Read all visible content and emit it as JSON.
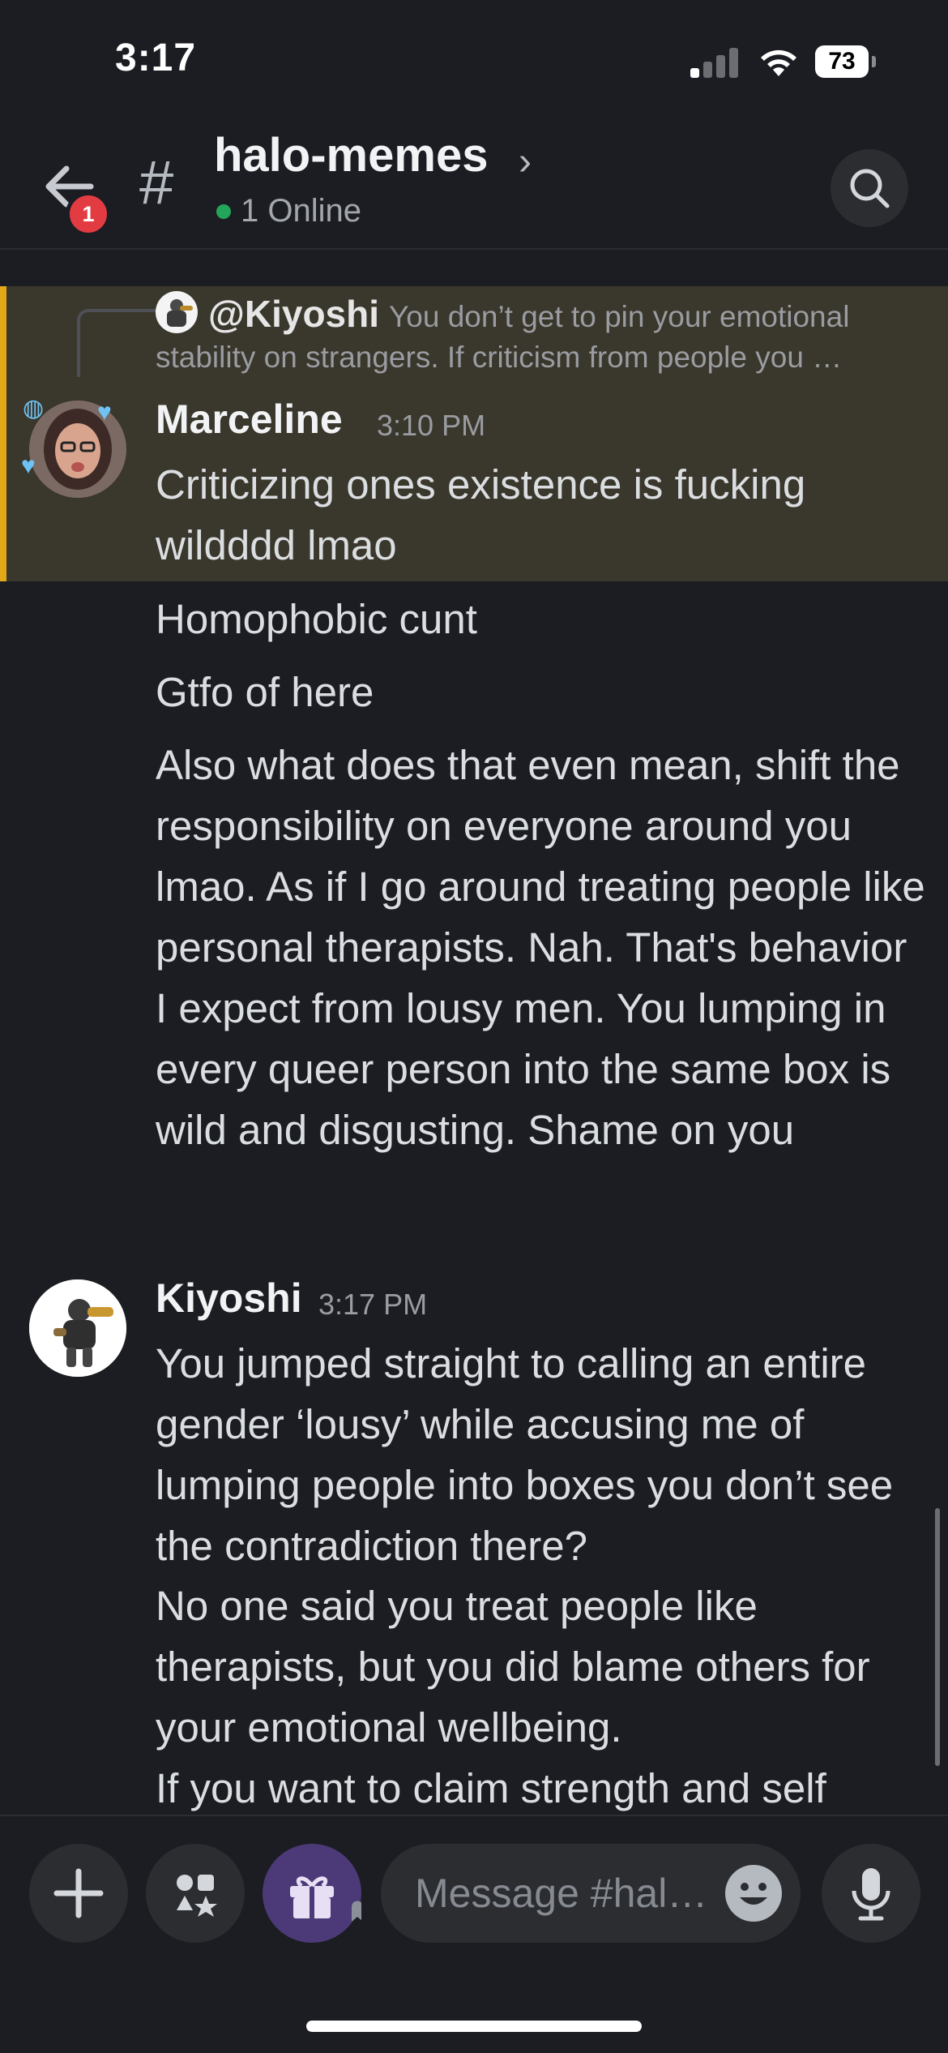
{
  "status_bar": {
    "time": "3:17",
    "battery": "73"
  },
  "header": {
    "channel_name": "halo-memes",
    "online_text": "1 Online",
    "back_badge": "1"
  },
  "reply_preview": {
    "author": "@Kiyoshi",
    "snippet_line1": "You don’t get to pin your emotional",
    "snippet_line2": "stability on strangers. If criticism from people you …"
  },
  "messages": [
    {
      "author": "Marceline",
      "time": "3:10 PM",
      "lines": [
        "Criticizing ones existence is fucking wildddd lmao",
        "Homophobic cunt",
        "Gtfo of here",
        "Also what does that even mean, shift the responsibility on everyone around you lmao. As if I go around treating people like personal therapists. Nah. That's behavior I expect from lousy men. You lumping in every queer person into the same box is wild and disgusting. Shame on you"
      ]
    },
    {
      "author": "Kiyoshi",
      "time": "3:17 PM",
      "lines": [
        "You jumped straight to calling an entire gender ‘lousy’ while accusing me of lumping people into boxes you don’t see the contradiction there?",
        "No one said you treat people like therapists, but you did blame others for your emotional wellbeing.",
        "If you want to claim strength and self"
      ]
    }
  ],
  "composer": {
    "placeholder": "Message #hal…"
  },
  "colors": {
    "background": "#1c1d22",
    "highlight": "#3a372c",
    "highlight_bar": "#e3a818",
    "online": "#23a55a",
    "badge": "#e23b42"
  }
}
